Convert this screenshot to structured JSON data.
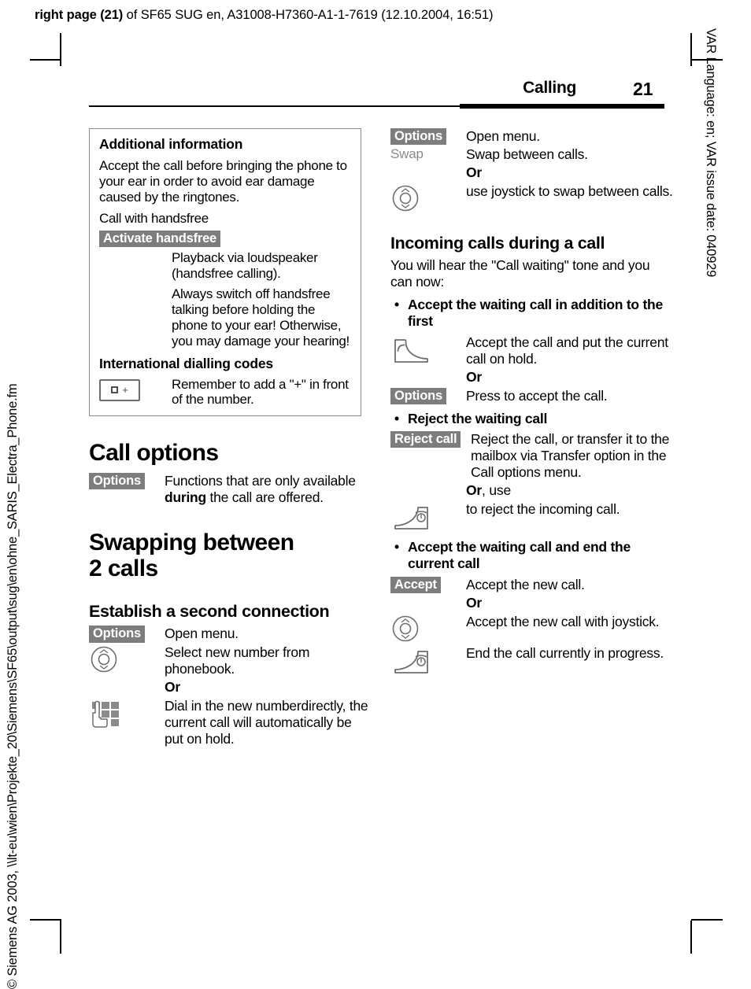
{
  "print_header": {
    "bold_prefix": "right page (21)",
    "rest": " of SF65 SUG en, A31008-H7360-A1-1-7619 (12.10.2004, 16:51)"
  },
  "side_texts": {
    "right": "VAR Language: en; VAR issue date: 040929",
    "left": "© Siemens AG 2003, \\\\lt-eu\\wien\\Projekte_20\\Siemens\\SF65\\output\\sug\\en\\ohne_SARIS_Electra_Phone.fm"
  },
  "header": {
    "chapter": "Calling",
    "page_number": "21"
  },
  "info_box": {
    "title": "Additional information",
    "paragraph_1": "Accept the call before bringing the phone to your ear in order to avoid ear damage caused by the ringtones.",
    "paragraph_2": "Call with handsfree",
    "softkey_handsfree": "Activate handsfree",
    "handsfree_desc_1": "Playback via loudspeaker (handsfree calling).",
    "handsfree_desc_2": "Always switch off handsfree talking before holding the phone to your ear! Otherwise, you may damage your hearing!",
    "subtitle_2": "International dialling codes",
    "key_zero_plus_label": "0 +",
    "dialling_desc": "Remember to add a \"+\" in front of the number."
  },
  "call_options": {
    "heading": "Call options",
    "softkey_options": "Options",
    "desc_part_1": "Functions that are only available ",
    "desc_bold": "during",
    "desc_part_2": " the call are offered."
  },
  "swapping": {
    "heading_line_1": "Swapping between",
    "heading_line_2": "2 calls",
    "subheading": "Establish a second connection",
    "rows": [
      {
        "key_type": "softkey",
        "key_label": "Options",
        "desc": "Open menu."
      },
      {
        "key_type": "joystick-icon",
        "key_label": "joystick-icon",
        "desc": "Select new number from phonebook."
      },
      {
        "key_type": "or",
        "key_label": "Or",
        "desc": ""
      },
      {
        "key_type": "keypad-icon",
        "key_label": "keypad-icon",
        "desc": "Dial in the new numberdirectly, the current call will automatically be put on hold."
      }
    ]
  },
  "swap_calls": {
    "rows": [
      {
        "key_type": "softkey",
        "key_label": "Options",
        "desc": "Open menu."
      },
      {
        "key_type": "plain",
        "key_label": "Swap",
        "desc": "Swap between calls."
      },
      {
        "key_type": "or",
        "key_label": "Or",
        "desc": ""
      },
      {
        "key_type": "joystick-icon",
        "key_label": "joystick-icon",
        "desc": "use joystick to swap between calls."
      }
    ]
  },
  "incoming": {
    "heading": "Incoming calls during a call",
    "intro": "You will hear the \"Call waiting\" tone and you can now:",
    "bullet_1": "Accept the waiting call in addition to the first",
    "bullet_1_rows": [
      {
        "key_type": "phone-accept-icon",
        "key_label": "phone-accept-icon",
        "desc": "Accept the call and put the current call on hold."
      },
      {
        "key_type": "or",
        "key_label": "Or",
        "desc": ""
      },
      {
        "key_type": "softkey",
        "key_label": "Options",
        "desc": "Press to accept the call."
      }
    ],
    "bullet_2": "Reject the waiting call",
    "bullet_2_rows": [
      {
        "key_type": "softkey",
        "key_label": "Reject call",
        "desc": "Reject the call, or transfer it to the mailbox via Transfer option in the Call options menu."
      },
      {
        "key_type": "or-use",
        "key_label": "Or",
        "key_label_suffix": ", use",
        "desc": ""
      },
      {
        "key_type": "phone-end-icon",
        "key_label": "phone-end-icon",
        "desc": "to reject the incoming call."
      }
    ],
    "bullet_3": "Accept the waiting call and end the current call",
    "bullet_3_rows": [
      {
        "key_type": "softkey",
        "key_label": "Accept",
        "desc": "Accept the new call."
      },
      {
        "key_type": "or",
        "key_label": "Or",
        "desc": ""
      },
      {
        "key_type": "joystick-icon",
        "key_label": "joystick-icon",
        "desc": "Accept the new call with joystick."
      },
      {
        "key_type": "phone-end-icon",
        "key_label": "phone-end-icon",
        "desc": "End the call currently in progress."
      }
    ]
  },
  "colors": {
    "softkey_bg": "#7d7d7d",
    "softkey_fg": "#ffffff",
    "icon_stroke": "#6e6e6e",
    "box_border": "#888888"
  }
}
